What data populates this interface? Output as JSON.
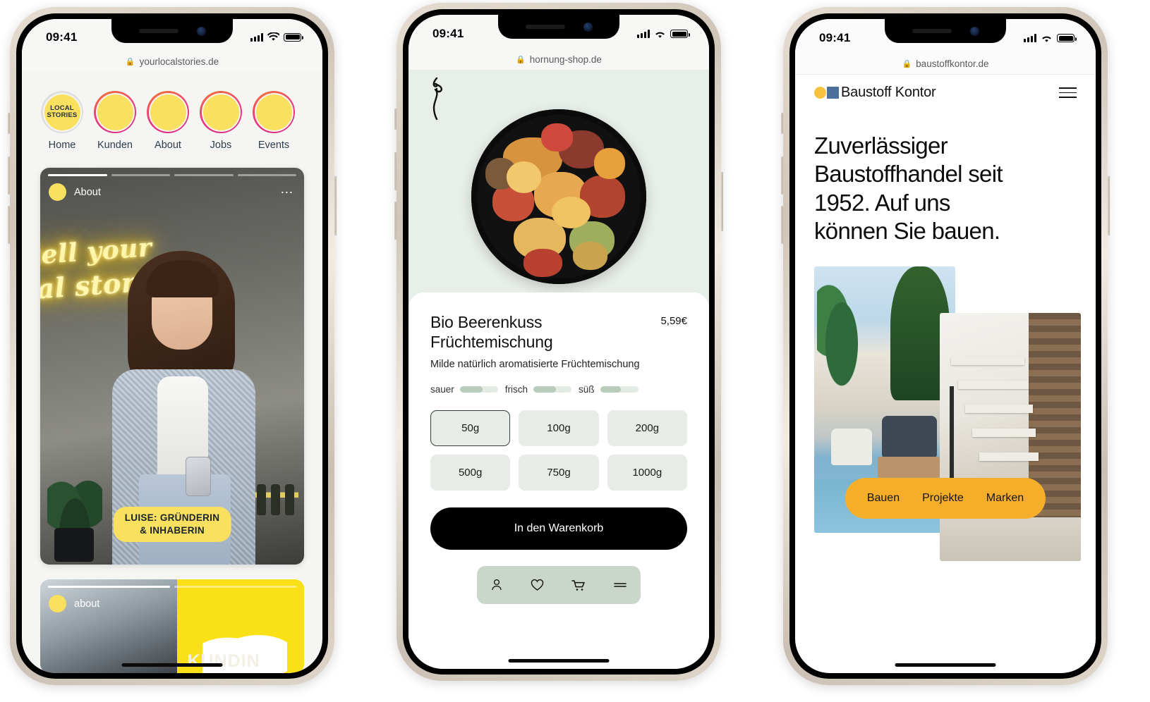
{
  "page": {
    "background": "#ffffff",
    "description": "Three iPhone mockups showing German websites"
  },
  "phones": [
    {
      "id": "phone-1",
      "status": {
        "time": "09:41",
        "signal_icon": "cellular-bars-icon",
        "wifi_icon": "wifi-icon",
        "battery_icon": "battery-full-icon"
      },
      "browser": {
        "url": "yourlocalstories.de",
        "lock_icon": "lock-icon"
      },
      "stories": [
        {
          "label": "Home",
          "badge": "LOCAL\nSTORIES",
          "badge_line1": "LOCAL",
          "badge_line2": "STORIES",
          "seen": true
        },
        {
          "label": "Kunden",
          "seen": false
        },
        {
          "label": "About",
          "seen": false
        },
        {
          "label": "Jobs",
          "seen": false
        },
        {
          "label": "Events",
          "seen": false
        }
      ],
      "story_card": {
        "handle": "About",
        "dots_icon": "more-options-icon",
        "neon_line1": "tell your",
        "neon_line2": "cal story",
        "caption_line1": "LUISE: GRÜNDERIN",
        "caption_line2": "& INHABERIN",
        "progress_segments": 4,
        "progress_active_index": 0
      },
      "next_card": {
        "handle": "about",
        "word": "KUNDIN",
        "progress_segments": 2,
        "progress_active_index": 0
      },
      "colors": {
        "yellow": "#fae05f",
        "ring_gradient_start": "#f47b2f",
        "ring_gradient_end": "#d7297f",
        "label": "#2e3d4d"
      }
    },
    {
      "id": "phone-2",
      "status": {
        "time": "09:41",
        "signal_icon": "cellular-bars-icon",
        "wifi_icon": "wifi-icon",
        "battery_icon": "battery-full-icon"
      },
      "browser": {
        "url": "hornung-shop.de",
        "lock_icon": "lock-icon"
      },
      "brand_logo_icon": "hornung-figure-logo-icon",
      "product": {
        "name_line1": "Bio Beerenkuss",
        "name_line2": "Früchtemischung",
        "price": "5,59€",
        "subtitle": "Milde natürlich aromatisierte Früchtemischung",
        "taste_attributes": [
          {
            "label": "sauer",
            "fill_percent": 60
          },
          {
            "label": "frisch",
            "fill_percent": 60
          },
          {
            "label": "süß",
            "fill_percent": 55
          }
        ],
        "sizes": [
          "50g",
          "100g",
          "200g",
          "500g",
          "750g",
          "1000g"
        ],
        "selected_size": "50g",
        "cart_button": "In den Warenkorb"
      },
      "tabbar": [
        {
          "icon": "user-account-icon"
        },
        {
          "icon": "heart-wishlist-icon"
        },
        {
          "icon": "shopping-cart-icon"
        },
        {
          "icon": "menu-lines-icon"
        }
      ],
      "colors": {
        "hero_bg": "#e8eee8",
        "tabbar_bg": "#c9d6c9",
        "size_bg": "#e7ece7",
        "cart_bg": "#000000"
      }
    },
    {
      "id": "phone-3",
      "status": {
        "time": "09:41",
        "signal_icon": "cellular-bars-icon",
        "wifi_icon": "wifi-icon",
        "battery_icon": "battery-full-icon"
      },
      "browser": {
        "url": "baustoffkontor.de",
        "lock_icon": "lock-icon"
      },
      "header": {
        "brand": "Baustoff Kontor",
        "logo_dot_icon": "yellow-circle-logo-icon",
        "logo_square_icon": "blue-square-logo-icon",
        "menu_icon": "hamburger-menu-icon"
      },
      "headline_line1": "Zuverlässiger",
      "headline_line2": "Baustoffhandel seit",
      "headline_line3": "1952. Auf uns",
      "headline_line4": "können Sie bauen.",
      "images": [
        {
          "name": "terrace-with-plants-photo"
        },
        {
          "name": "modern-staircase-interior-photo"
        }
      ],
      "nav_pill": [
        "Bauen",
        "Projekte",
        "Marken"
      ],
      "colors": {
        "pill": "#f5ae2a",
        "logo_dot": "#f7c33f",
        "logo_square": "#4c6f9e"
      }
    }
  ]
}
